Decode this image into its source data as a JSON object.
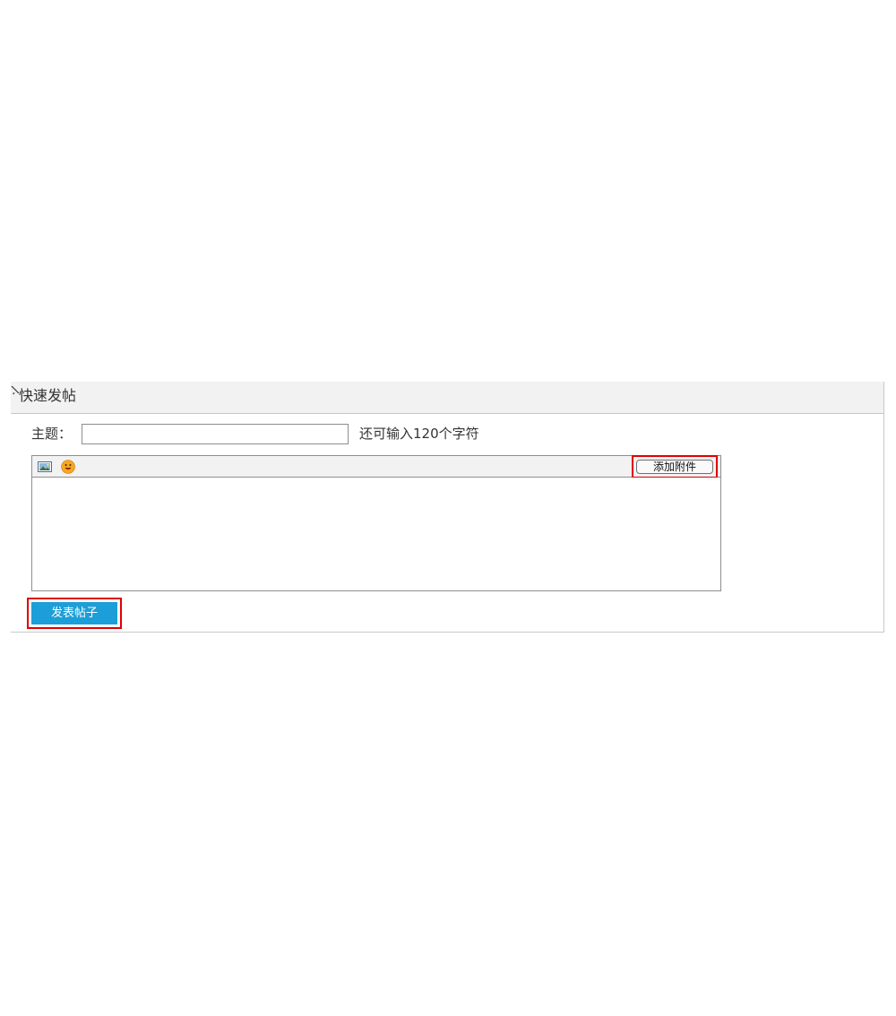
{
  "quick_post": {
    "title": "快速发帖",
    "collapse_icon": "arrow-icon",
    "subject_label": "主题：",
    "subject_value": "",
    "char_hint": "还可输入120个字符",
    "toolbar": {
      "icons": [
        "image-icon",
        "emoji-icon"
      ],
      "attach_label": "添加附件"
    },
    "content_value": "",
    "submit_label": "发表帖子"
  },
  "colors": {
    "header_bg": "#f2f2f2",
    "border": "#c8c8c8",
    "submit_bg": "#1c9ed8",
    "highlight": "#e00000"
  }
}
